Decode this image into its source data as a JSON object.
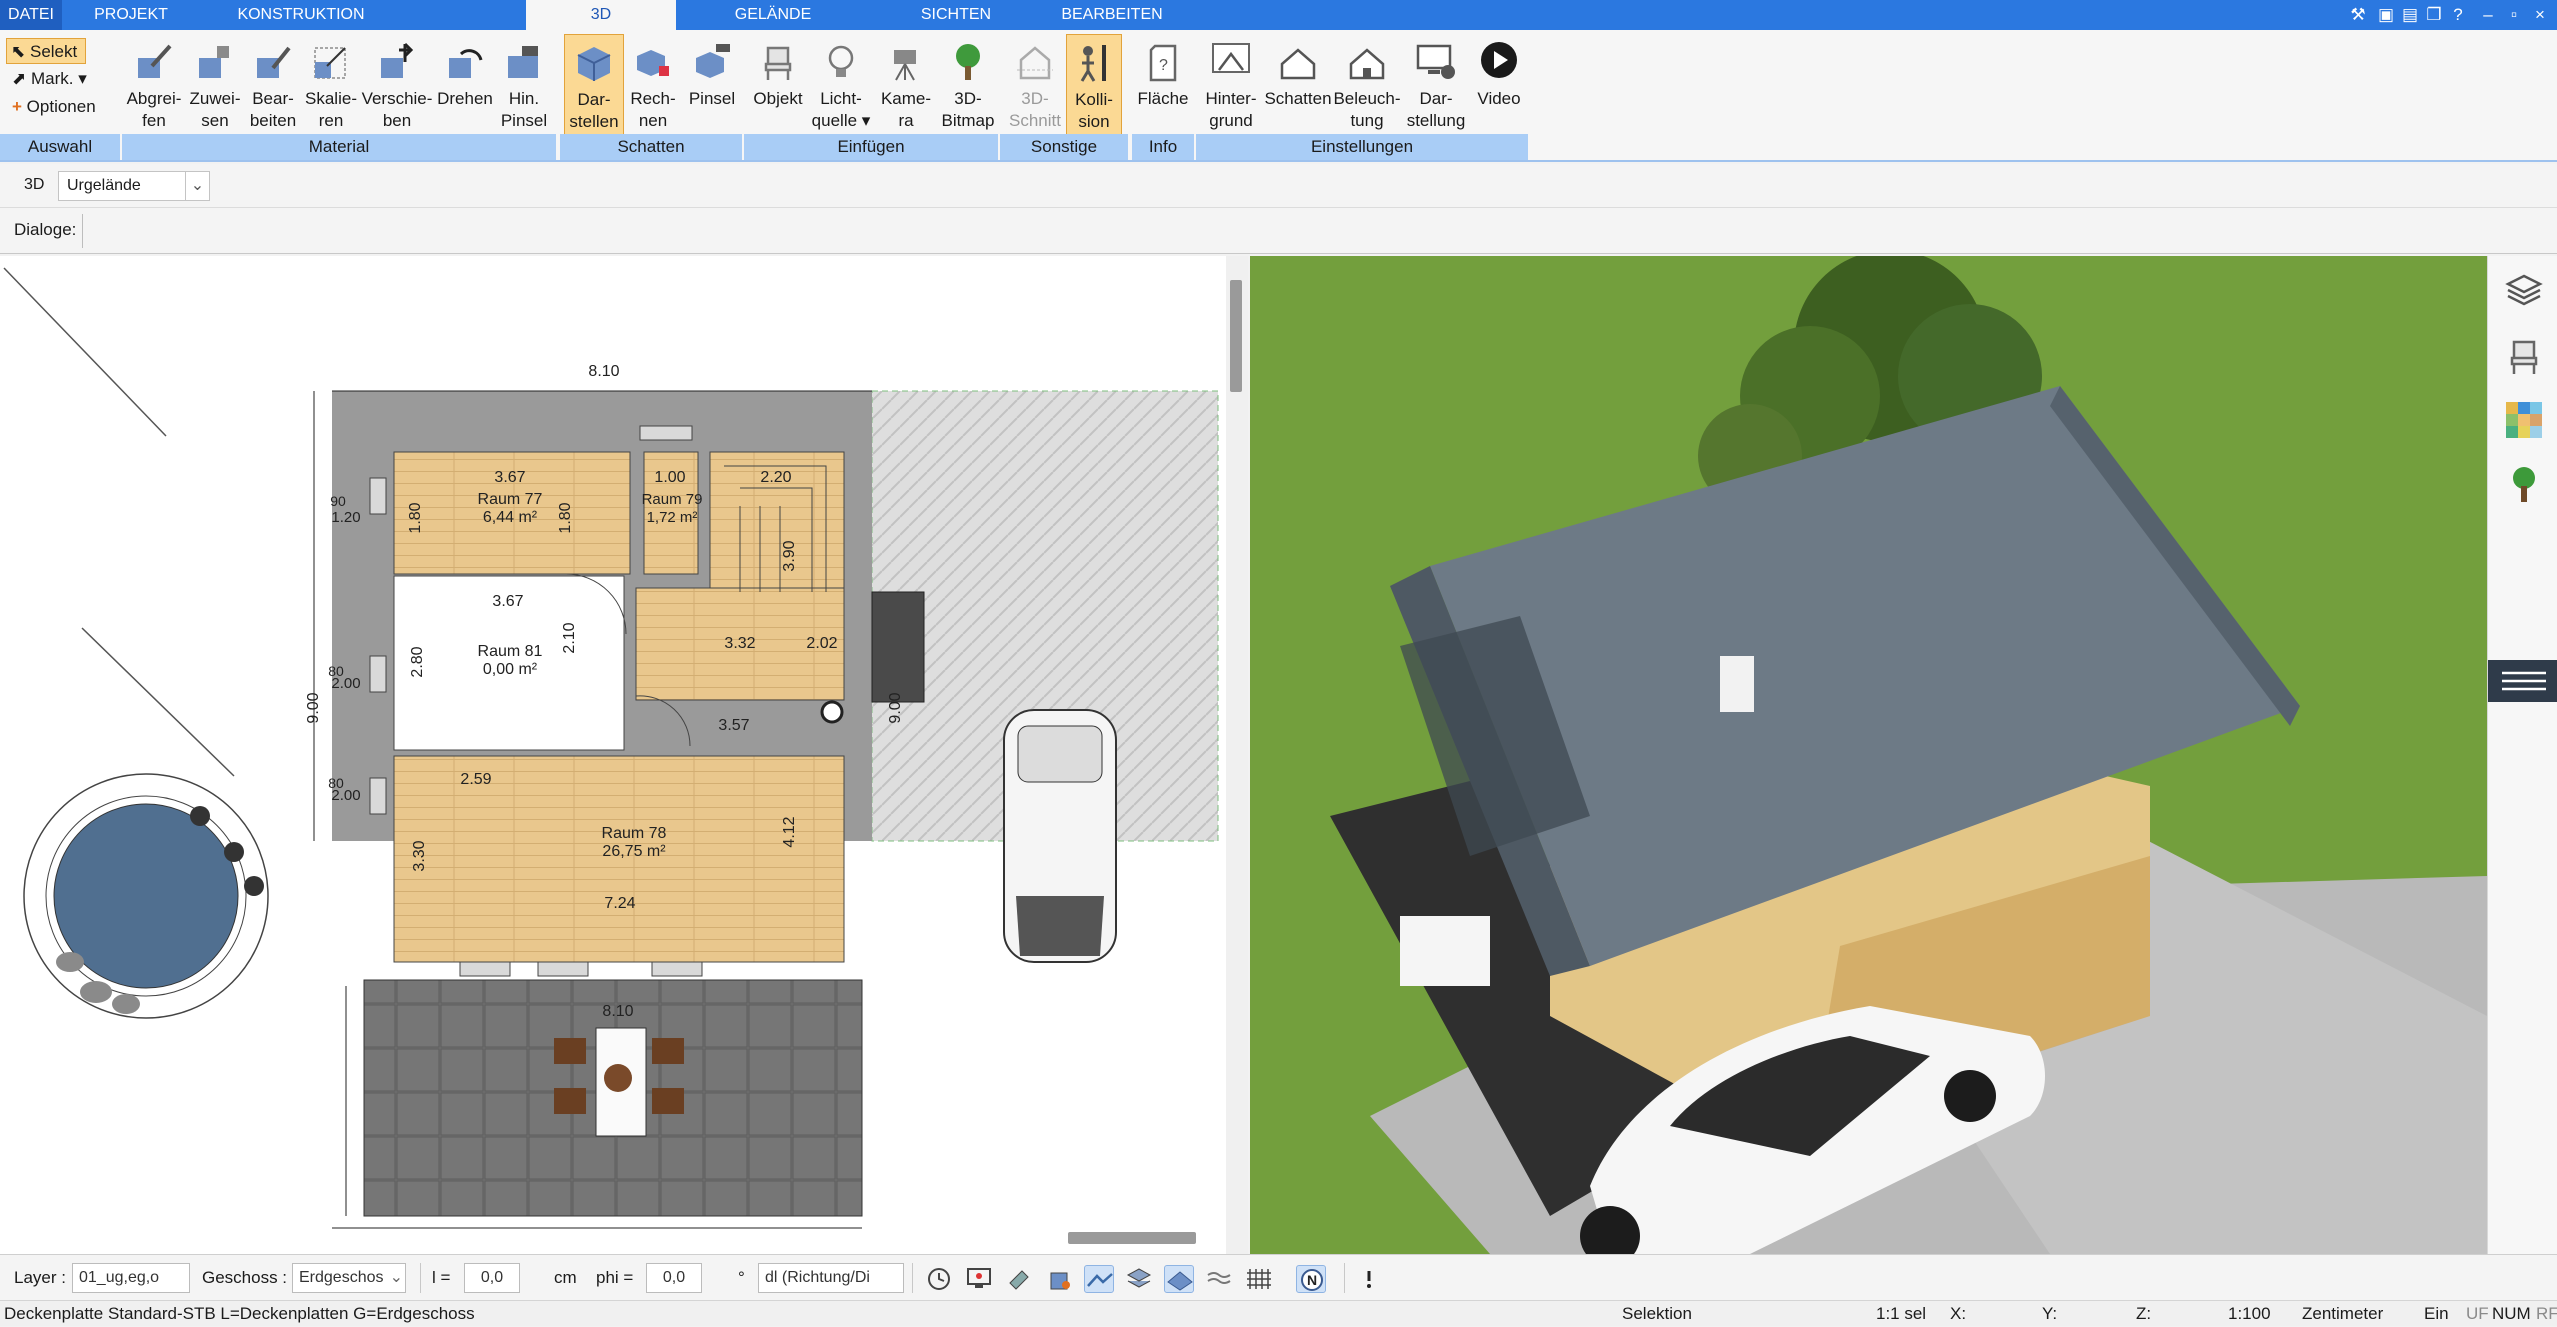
{
  "menu": {
    "tabs": [
      {
        "label": "DATEI"
      },
      {
        "label": "PROJEKT"
      },
      {
        "label": "KONSTRUKTION"
      },
      {
        "label": "3D"
      },
      {
        "label": "GELÄNDE"
      },
      {
        "label": "SICHTEN"
      },
      {
        "label": "BEARBEITEN"
      }
    ],
    "active_tab": "3D"
  },
  "ribbon": {
    "selection": {
      "select": "Selekt",
      "mark": "Mark.",
      "options": "Optionen",
      "group": "Auswahl"
    },
    "material": {
      "group": "Material",
      "buttons": [
        {
          "l1": "Abgrei-",
          "l2": "fen"
        },
        {
          "l1": "Zuwei-",
          "l2": "sen"
        },
        {
          "l1": "Bear-",
          "l2": "beiten"
        },
        {
          "l1": "Skalie-",
          "l2": "ren"
        },
        {
          "l1": "Verschie-",
          "l2": "ben"
        },
        {
          "l1": "Drehen",
          "l2": ""
        },
        {
          "l1": "Hin.",
          "l2": "Pinsel"
        }
      ]
    },
    "schatten": {
      "group": "Schatten",
      "buttons": [
        {
          "l1": "Dar-",
          "l2": "stellen"
        },
        {
          "l1": "Rech-",
          "l2": "nen"
        },
        {
          "l1": "Pinsel",
          "l2": ""
        }
      ]
    },
    "einfuegen": {
      "group": "Einfügen",
      "buttons": [
        {
          "l1": "Objekt",
          "l2": ""
        },
        {
          "l1": "Licht-",
          "l2": "quelle"
        },
        {
          "l1": "Kame-",
          "l2": "ra"
        },
        {
          "l1": "3D-",
          "l2": "Bitmap"
        }
      ]
    },
    "sonstige": {
      "group": "Sonstige",
      "buttons": [
        {
          "l1": "3D-",
          "l2": "Schnitt"
        },
        {
          "l1": "Kolli-",
          "l2": "sion"
        }
      ]
    },
    "info": {
      "group": "Info",
      "buttons": [
        {
          "l1": "Fläche",
          "l2": ""
        }
      ]
    },
    "einstellungen": {
      "group": "Einstellungen",
      "buttons": [
        {
          "l1": "Hinter-",
          "l2": "grund"
        },
        {
          "l1": "Schatten",
          "l2": ""
        },
        {
          "l1": "Beleuch-",
          "l2": "tung"
        },
        {
          "l1": "Dar-",
          "l2": "stellung"
        },
        {
          "l1": "Video",
          "l2": ""
        }
      ]
    }
  },
  "toolbar2": {
    "mode": "3D",
    "terrain_select": "Urgelände"
  },
  "toolbar3": {
    "dialogs_label": "Dialoge:"
  },
  "plan": {
    "rooms": [
      {
        "name": "Raum 77",
        "area": "6,44 m²"
      },
      {
        "name": "Raum 79",
        "area": "1,72 m²"
      },
      {
        "name": "Raum 81",
        "area": "0,00 m²"
      },
      {
        "name": "Raum 78",
        "area": "26,75 m²"
      }
    ],
    "dims": {
      "top_width": "8.10",
      "bottom_width": "8.10",
      "left_height": "9.00",
      "right_height": "9.00",
      "r77_w": "3.67",
      "r77_w2": "3.67",
      "r77_h": "1.80",
      "r77_h2": "1.80",
      "r79_w": "1.00",
      "stair_w": "2.20",
      "r81_w": "3.67",
      "r81_h": "2.80",
      "r81_h2": "2.10",
      "hall_w": "3.57",
      "hall_w2": "3.32",
      "hall_h": "2.02",
      "stair_h": "3.90",
      "r78_w": "2.59",
      "r78_w2": "7.24",
      "r78_h": "3.30",
      "r78_h2": "4.12",
      "w1": "2.00",
      "w2": "2.00",
      "w3": "1.20",
      "d80a": "80",
      "d80b": "80",
      "d90": "90"
    }
  },
  "bottom": {
    "layer_label": "Layer :",
    "layer_value": "01_ug,eg,o",
    "floor_label": "Geschoss :",
    "floor_value": "Erdgeschos",
    "l_label": "l =",
    "l_value": "0,0",
    "unit": "cm",
    "phi_label": "phi =",
    "phi_value": "0,0",
    "deg": "°",
    "dl_value": "dl (Richtung/Di"
  },
  "status": {
    "left": "Deckenplatte Standard-STB L=Deckenplatten G=Erdgeschoss",
    "mode": "Selektion",
    "sel": "1:1 sel",
    "x": "X:",
    "y": "Y:",
    "z": "Z:",
    "scale": "1:100",
    "unit": "Zentimeter",
    "ein": "Ein",
    "uf": "UF",
    "num": "NUM",
    "rf": "RF"
  },
  "colors": {
    "accent": "#2b78e0",
    "ribbon_group": "#a9cdf6",
    "active_button": "#fbd994",
    "floor_wood": "#e8c48a",
    "lawn": "#6f9a3a",
    "roof": "#6d7a86"
  }
}
